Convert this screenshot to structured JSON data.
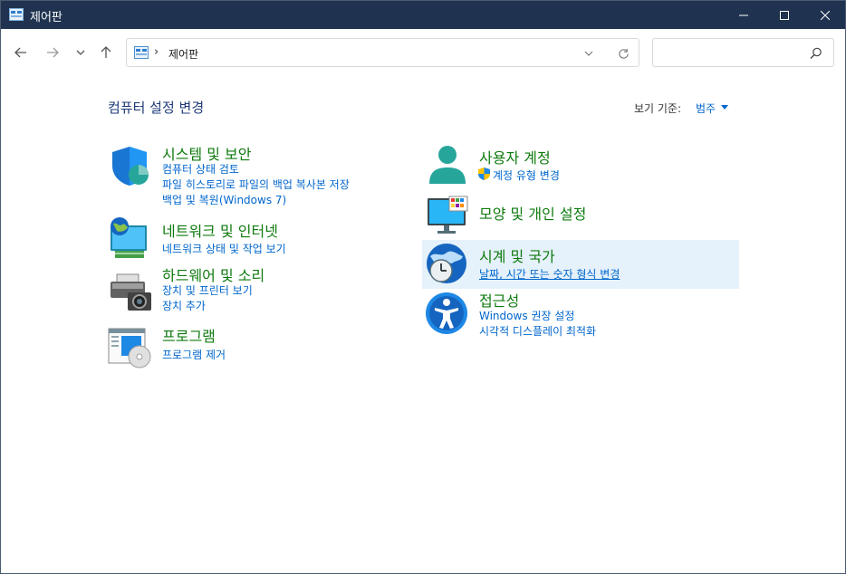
{
  "window": {
    "title": "제어판"
  },
  "address": {
    "breadcrumb": "제어판"
  },
  "search": {
    "placeholder": "",
    "value": ""
  },
  "heading": "컴퓨터 설정 변경",
  "view_by": {
    "label": "보기 기준:",
    "value": "범주"
  },
  "categories": {
    "system": {
      "title": "시스템 및 보안",
      "links": [
        "컴퓨터 상태 검토",
        "파일 히스토리로 파일의 백업 복사본 저장",
        "백업 및 복원(Windows 7)"
      ]
    },
    "network": {
      "title": "네트워크 및 인터넷",
      "links": [
        "네트워크 상태 및 작업 보기"
      ]
    },
    "hardware": {
      "title": "하드웨어 및 소리",
      "links": [
        "장치 및 프린터 보기",
        "장치 추가"
      ]
    },
    "programs": {
      "title": "프로그램",
      "links": [
        "프로그램 제거"
      ]
    },
    "accounts": {
      "title": "사용자 계정",
      "links": [
        "계정 유형 변경"
      ]
    },
    "appearance": {
      "title": "모양 및 개인 설정",
      "links": []
    },
    "clock": {
      "title": "시계 및 국가",
      "links": [
        "날짜, 시간 또는 숫자 형식 변경"
      ]
    },
    "ease": {
      "title": "접근성",
      "links": [
        "Windows 권장 설정",
        "시각적 디스플레이 최적화"
      ]
    }
  },
  "colors": {
    "titlebar": "#1f3350",
    "category_title": "#0f7b0f",
    "link": "#0066cc",
    "heading": "#1e3a78",
    "hover_bg": "#e5f1fb"
  }
}
